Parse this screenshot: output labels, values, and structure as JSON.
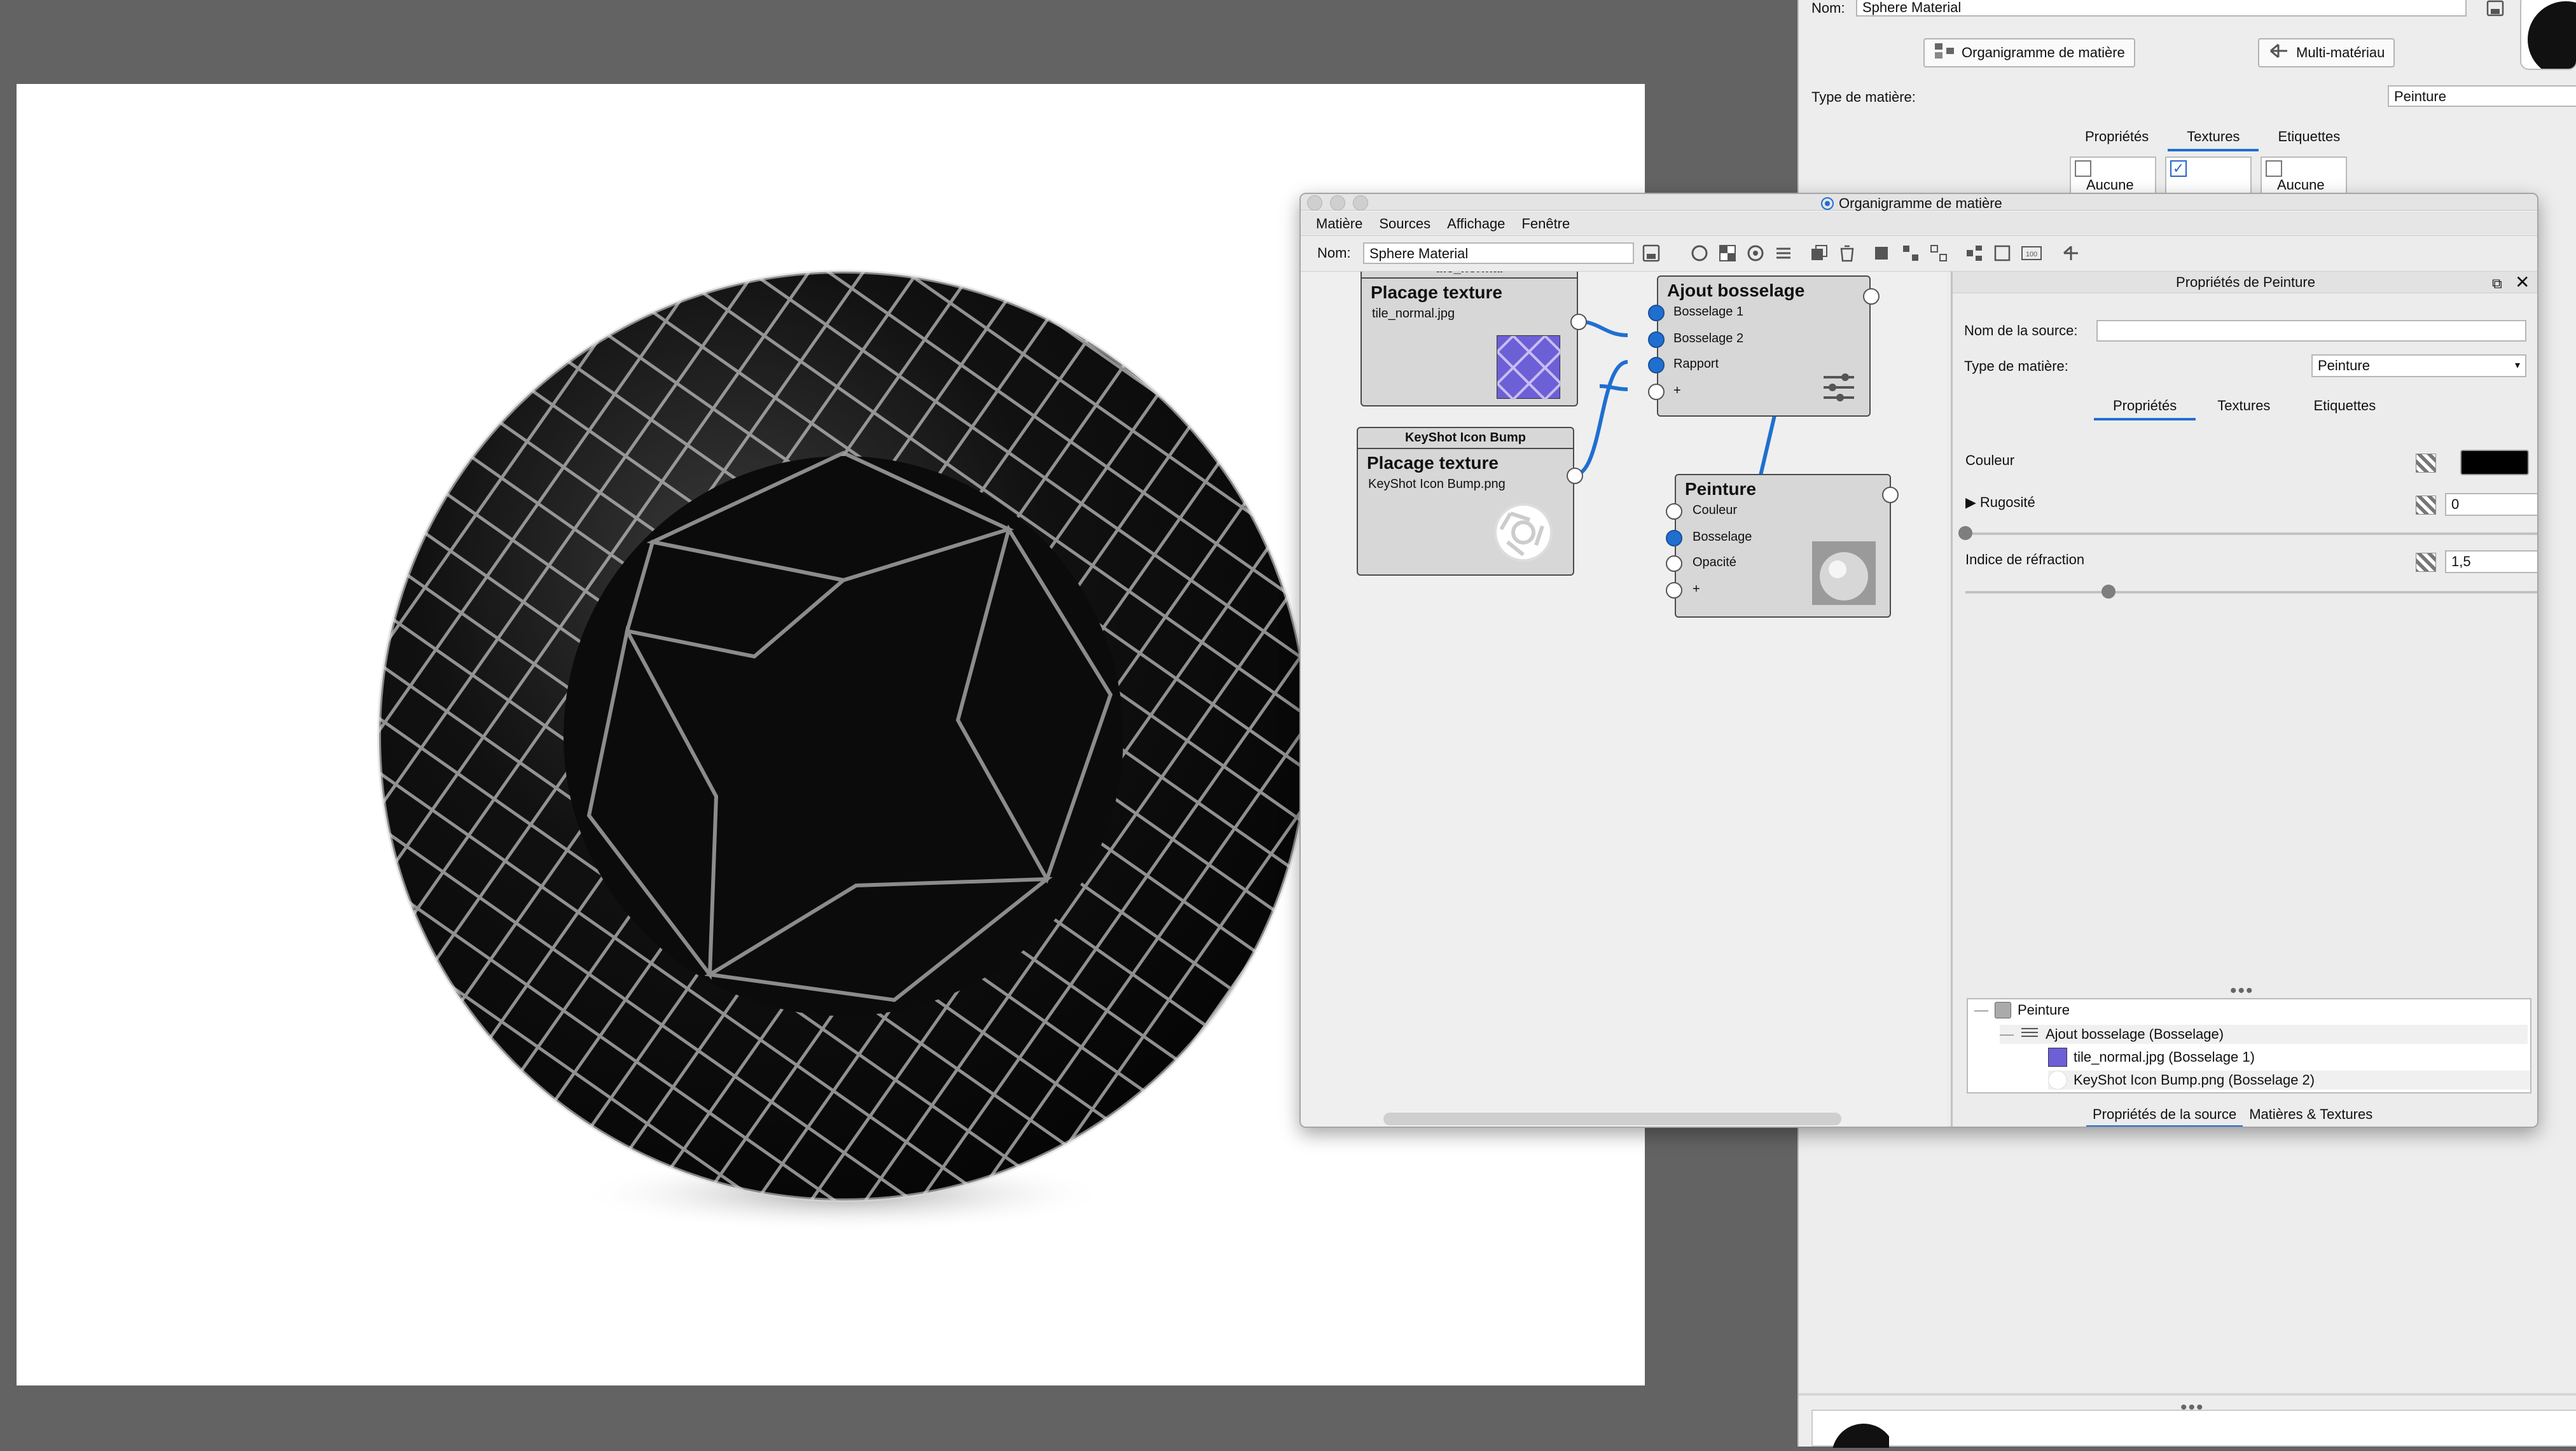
{
  "right_panel": {
    "name_label": "Nom:",
    "name_value": "Sphere Material",
    "btn_graph": "Organigramme de matière",
    "btn_multi": "Multi-matériau",
    "type_label": "Type de matière:",
    "type_value": "Peinture",
    "tabs": [
      "Propriétés",
      "Textures",
      "Etiquettes"
    ],
    "texture_slots": [
      "Aucune",
      "",
      "Aucune"
    ]
  },
  "graph_window": {
    "title": "Organigramme de matière",
    "menu": [
      "Matière",
      "Sources",
      "Affichage",
      "Fenêtre"
    ],
    "name_label": "Nom:",
    "name_value": "Sphere Material",
    "nodes": {
      "tile": {
        "header": "tile_normal",
        "title": "Placage texture",
        "file": "tile_normal.jpg"
      },
      "icon": {
        "header": "KeyShot Icon Bump",
        "title": "Placage texture",
        "file": "KeyShot Icon Bump.png"
      },
      "bump": {
        "title": "Ajout bosselage",
        "inputs": [
          "Bosselage 1",
          "Bosselage 2",
          "Rapport",
          "+"
        ]
      },
      "paint": {
        "title": "Peinture",
        "inputs": [
          "Couleur",
          "Bosselage",
          "Opacité",
          "+"
        ]
      }
    }
  },
  "properties": {
    "title": "Propriétés de Peinture",
    "source_name_label": "Nom de la source:",
    "source_name_value": "",
    "type_label": "Type de matière:",
    "type_value": "Peinture",
    "tabs": [
      "Propriétés",
      "Textures",
      "Etiquettes"
    ],
    "color_label": "Couleur",
    "color_value": "#000000",
    "roughness_label": "Rugosité",
    "roughness_value": "0",
    "roughness_fraction": 0.0,
    "ior_label": "Indice de réfraction",
    "ior_value": "1,5",
    "ior_fraction": 0.25,
    "tree": [
      {
        "label": "Peinture"
      },
      {
        "label": "Ajout bosselage (Bosselage)"
      },
      {
        "label": "tile_normal.jpg (Bosselage 1)"
      },
      {
        "label": "KeyShot Icon Bump.png (Bosselage 2)"
      }
    ],
    "bottom_tabs": [
      "Propriétés de la source",
      "Matières & Textures"
    ]
  }
}
